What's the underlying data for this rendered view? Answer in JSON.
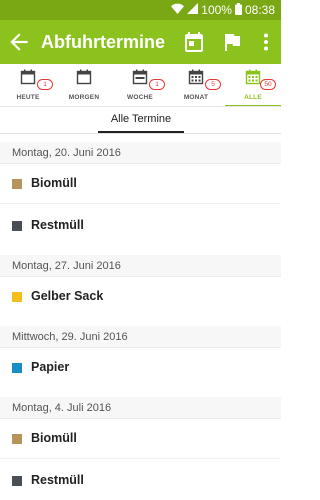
{
  "status_bar": {
    "battery": "100%",
    "time": "08:38"
  },
  "app_bar": {
    "title": "Abfuhrtermine",
    "icons": [
      "arrow-back-icon",
      "calendar-today-icon",
      "flag-icon",
      "more-vert-icon"
    ]
  },
  "period_tabs": [
    {
      "label": "HEUTE",
      "badge": "1",
      "icon": "calendar-blank-icon"
    },
    {
      "label": "MORGEN",
      "badge": "",
      "icon": "calendar-blank-icon"
    },
    {
      "label": "WOCHE",
      "badge": "1",
      "icon": "calendar-week-icon"
    },
    {
      "label": "MONAT",
      "badge": "5",
      "icon": "calendar-month-icon"
    },
    {
      "label": "ALLE",
      "badge": "50",
      "icon": "calendar-all-icon",
      "active": true
    }
  ],
  "sub_tab": {
    "label": "Alle Termine"
  },
  "groups": [
    {
      "date": "Montag, 20. Juni 2016",
      "items": [
        {
          "label": "Biomüll",
          "color": "#b8935a"
        },
        {
          "label": "Restmüll",
          "color": "#4a4f56"
        }
      ]
    },
    {
      "date": "Montag, 27. Juni 2016",
      "items": [
        {
          "label": "Gelber Sack",
          "color": "#f5be1a"
        }
      ]
    },
    {
      "date": "Mittwoch, 29. Juni 2016",
      "items": [
        {
          "label": "Papier",
          "color": "#1a8cc8"
        }
      ]
    },
    {
      "date": "Montag, 4. Juli 2016",
      "items": [
        {
          "label": "Biomüll",
          "color": "#b8935a"
        },
        {
          "label": "Restmüll",
          "color": "#4a4f56"
        }
      ]
    }
  ],
  "colors": {
    "accent": "#8cc21e",
    "status_bar": "#7aa814",
    "badge": "#e53935"
  }
}
